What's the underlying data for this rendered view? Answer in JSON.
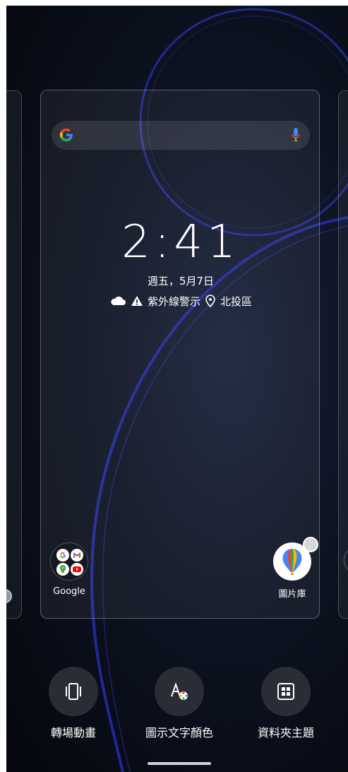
{
  "preview": {
    "clock": "2:41",
    "date": "週五，5月7日",
    "weather_alert": "紫外線警示",
    "location": "北投區",
    "search_icons": [
      "google-g-icon",
      "mic-icon"
    ]
  },
  "apps": {
    "google_folder_label": "Google",
    "gallery_label": "圖片庫"
  },
  "bottom_options": {
    "transition_label": "轉場動畫",
    "icon_text_color_label": "圖示文字顏色",
    "folder_theme_label": "資料夾主題"
  },
  "colors": {
    "background": "#0d1322",
    "accent_arc": "#2b36c9",
    "button_bg": "#2a2d35"
  }
}
